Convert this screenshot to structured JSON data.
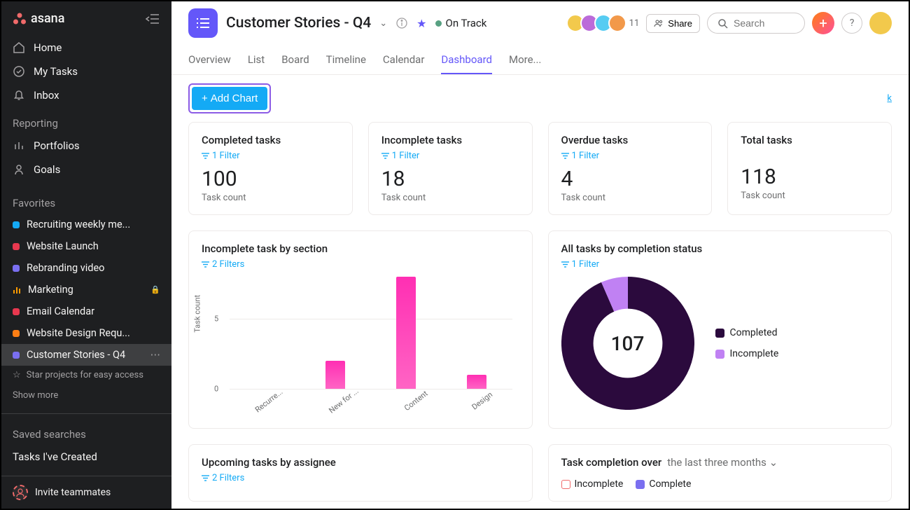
{
  "brand": "asana",
  "sidebar": {
    "nav": [
      {
        "label": "Home"
      },
      {
        "label": "My Tasks"
      },
      {
        "label": "Inbox"
      }
    ],
    "reporting_title": "Reporting",
    "reporting": [
      {
        "label": "Portfolios"
      },
      {
        "label": "Goals"
      }
    ],
    "favorites_title": "Favorites",
    "favorites": [
      {
        "label": "Recruiting weekly me...",
        "color": "#14aaf5"
      },
      {
        "label": "Website Launch",
        "color": "#e8384f"
      },
      {
        "label": "Rebranding video",
        "color": "#7a6ff0"
      },
      {
        "label": "Marketing",
        "color": "#fd9a00",
        "locked": true,
        "bar_icon": true
      },
      {
        "label": "Email Calendar",
        "color": "#e8384f"
      },
      {
        "label": "Website Design Requ...",
        "color": "#fd7e14"
      },
      {
        "label": "Customer Stories - Q4",
        "color": "#7a6ff0",
        "active": true
      }
    ],
    "star_tip": "Star projects for easy access",
    "show_more": "Show more",
    "saved_title": "Saved searches",
    "saved": [
      {
        "label": "Tasks I've Created"
      }
    ],
    "invite": "Invite teammates"
  },
  "header": {
    "title": "Customer Stories - Q4",
    "status": "On Track",
    "avatar_overflow": "11",
    "share": "Share",
    "search_placeholder": "Search",
    "tabs": [
      "Overview",
      "List",
      "Board",
      "Timeline",
      "Calendar",
      "Dashboard",
      "More..."
    ],
    "active_tab": "Dashboard"
  },
  "toolbar": {
    "add_chart": "Add Chart",
    "feedback": "k"
  },
  "metrics": [
    {
      "title": "Completed tasks",
      "filter": "1 Filter",
      "value": "100",
      "sub": "Task count"
    },
    {
      "title": "Incomplete tasks",
      "filter": "1 Filter",
      "value": "18",
      "sub": "Task count"
    },
    {
      "title": "Overdue tasks",
      "filter": "1 Filter",
      "value": "4",
      "sub": "Task count"
    },
    {
      "title": "Total tasks",
      "filter": "",
      "value": "118",
      "sub": "Task count"
    }
  ],
  "bar_chart": {
    "title": "Incomplete task by section",
    "filter": "2 Filters",
    "ylabel": "Task count"
  },
  "donut_chart": {
    "title": "All tasks by completion status",
    "filter": "1 Filter",
    "center": "107",
    "legend": [
      {
        "label": "Completed",
        "color": "#2b0a3d"
      },
      {
        "label": "Incomplete",
        "color": "#c081f3"
      }
    ]
  },
  "upcoming": {
    "title": "Upcoming tasks by assignee",
    "filter": "2 Filters"
  },
  "completion": {
    "title": "Task completion over",
    "period": "the last three months",
    "opts": [
      {
        "label": "Incomplete",
        "color": "#ffffff",
        "border": "#f06a6a"
      },
      {
        "label": "Complete",
        "color": "#7a6ff0"
      }
    ]
  },
  "chart_data": [
    {
      "type": "bar",
      "title": "Incomplete task by section",
      "ylabel": "Task count",
      "ylim": [
        0,
        8
      ],
      "categories": [
        "Recurre...",
        "New for ...",
        "Content",
        "Design"
      ],
      "values": [
        0,
        2,
        8,
        1
      ]
    },
    {
      "type": "pie",
      "title": "All tasks by completion status",
      "series": [
        {
          "name": "Completed",
          "value": 100,
          "color": "#2b0a3d"
        },
        {
          "name": "Incomplete",
          "value": 7,
          "color": "#c081f3"
        }
      ],
      "center_label": "107"
    }
  ]
}
